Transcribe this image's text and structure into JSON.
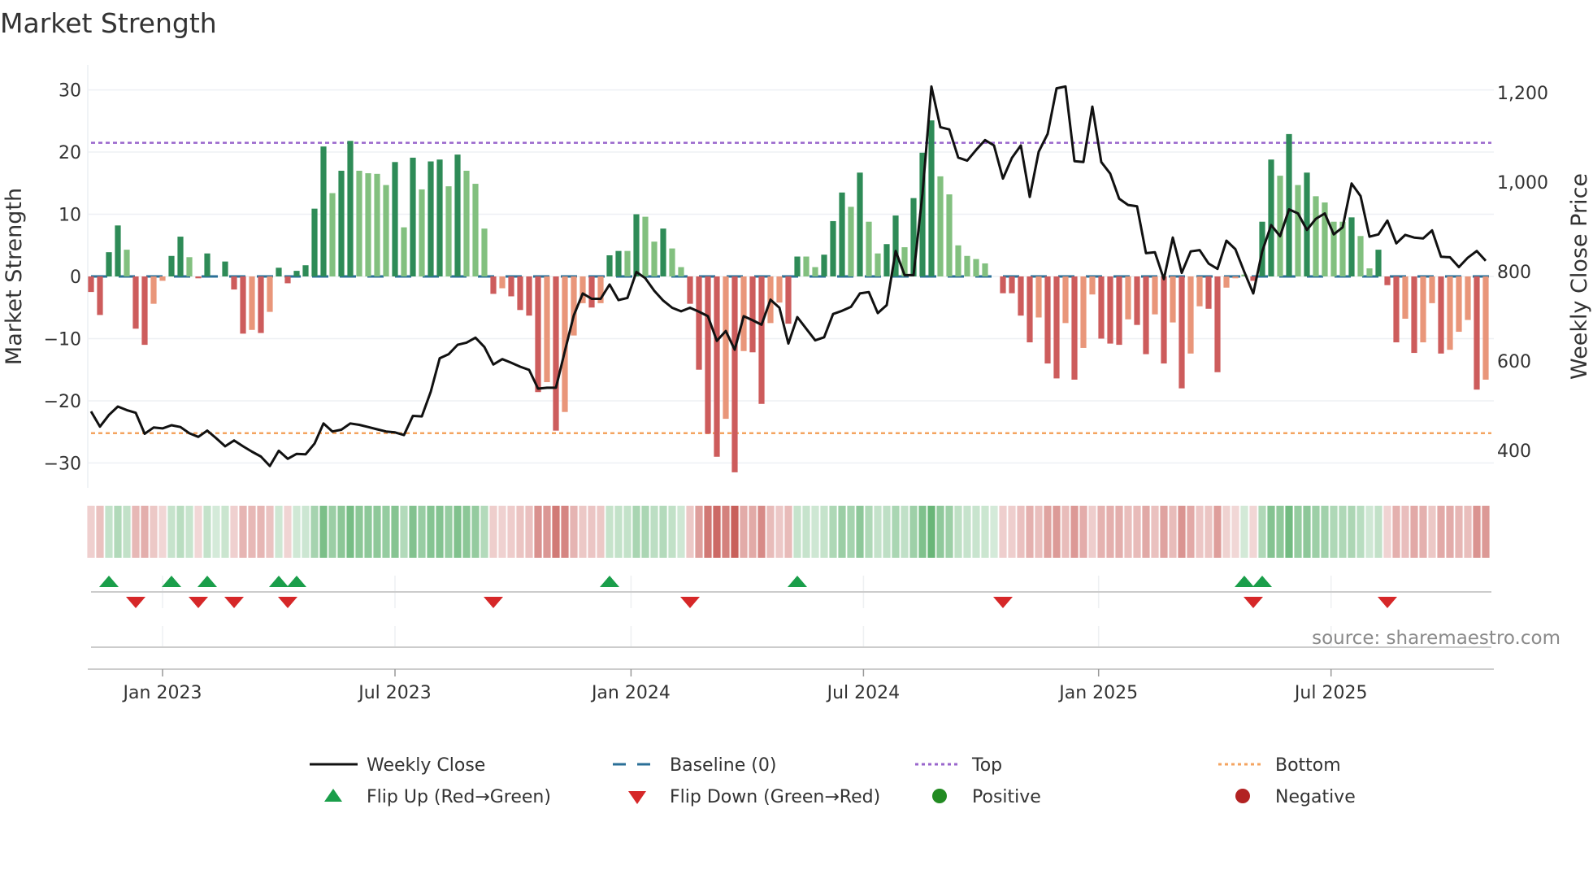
{
  "chart_data": {
    "type": "bar",
    "title": "Market Strength",
    "ylabel": "Market Strength",
    "ylabel_right": "Weekly Close Price",
    "ylim": [
      -34,
      34
    ],
    "ylim_right": [
      316,
      1262
    ],
    "yticks": [
      30,
      20,
      10,
      0,
      -10,
      -20,
      -30
    ],
    "ytick_labels": [
      "30",
      "20",
      "10",
      "0",
      "−10",
      "−20",
      "−30"
    ],
    "yticks_right": [
      1200,
      1000,
      800,
      600,
      400
    ],
    "ytick_labels_right": [
      "1,200",
      "1,000",
      "800",
      "600",
      "400"
    ],
    "xticks": [
      {
        "week_index": 8.0,
        "label": "Jan 2023"
      },
      {
        "week_index": 34.0,
        "label": "Jul 2023"
      },
      {
        "week_index": 60.4,
        "label": "Jan 2024"
      },
      {
        "week_index": 86.4,
        "label": "Jul 2024"
      },
      {
        "week_index": 112.7,
        "label": "Jan 2025"
      },
      {
        "week_index": 138.7,
        "label": "Jul 2025"
      }
    ],
    "top_level": 21.5,
    "bottom_level": -25.2,
    "baseline": 0,
    "strength": [
      -2.5,
      -6.2,
      3.9,
      8.2,
      4.3,
      -8.4,
      -11,
      -4.4,
      -0.7,
      3.3,
      6.4,
      3.1,
      -0.3,
      3.7,
      0,
      2.4,
      -2.1,
      -9.2,
      -8.6,
      -9.1,
      -5.7,
      1.4,
      -1.1,
      0.9,
      1.8,
      10.9,
      20.9,
      13.4,
      17,
      21.8,
      17,
      16.6,
      16.5,
      14.7,
      18.4,
      7.9,
      19.1,
      14,
      18.5,
      18.8,
      14.5,
      19.6,
      17,
      14.9,
      7.7,
      -2.8,
      -1.9,
      -3.2,
      -5.4,
      -6.3,
      -18.6,
      -17,
      -24.8,
      -21.8,
      -9.5,
      -4.3,
      -5,
      -4.3,
      3.4,
      4.1,
      4.1,
      10,
      9.6,
      5.6,
      7.7,
      4.5,
      1.5,
      -4.4,
      -15,
      -25.3,
      -29,
      -22.9,
      -31.5,
      -12,
      -12.2,
      -20.5,
      -7.5,
      -4.2,
      -7.6,
      3.2,
      3.2,
      1.5,
      3.5,
      8.9,
      13.5,
      11.2,
      16.7,
      8.8,
      3.7,
      5.2,
      9.8,
      4.7,
      12.6,
      19.9,
      25.1,
      16.1,
      13.2,
      5,
      3.3,
      2.8,
      2.1,
      0,
      -2.7,
      -2.7,
      -6.3,
      -10.6,
      -6.6,
      -14,
      -16.4,
      -7.5,
      -16.6,
      -11.5,
      -2.9,
      -10,
      -10.8,
      -11,
      -6.9,
      -7.8,
      -12.5,
      -6.1,
      -14,
      -7.4,
      -18,
      -12.4,
      -4.8,
      -5.2,
      -15.4,
      -1.8,
      -0.3,
      0.3,
      -0.7,
      8.8,
      18.8,
      16.2,
      22.9,
      14.7,
      16.7,
      12.9,
      11.9,
      8.8,
      8.8,
      9.5,
      6.5,
      1.3,
      4.3,
      -1.4,
      -10.6,
      -6.8,
      -12.3,
      -10.6,
      -4.3,
      -12.4,
      -11.8,
      -8.9,
      -7,
      -18.2,
      -16.6
    ],
    "shade": [
      "D",
      "D",
      "D",
      "D",
      "L",
      "D",
      "D",
      "L",
      "L",
      "D",
      "D",
      "L",
      "D",
      "D",
      "L",
      "D",
      "D",
      "D",
      "L",
      "D",
      "L",
      "D",
      "D",
      "D",
      "D",
      "D",
      "D",
      "L",
      "D",
      "D",
      "L",
      "L",
      "L",
      "L",
      "D",
      "L",
      "D",
      "L",
      "D",
      "D",
      "L",
      "D",
      "L",
      "L",
      "L",
      "D",
      "L",
      "D",
      "D",
      "D",
      "D",
      "L",
      "D",
      "L",
      "L",
      "L",
      "D",
      "L",
      "D",
      "D",
      "L",
      "D",
      "L",
      "L",
      "D",
      "L",
      "L",
      "D",
      "D",
      "D",
      "D",
      "L",
      "D",
      "L",
      "D",
      "D",
      "L",
      "L",
      "D",
      "D",
      "L",
      "L",
      "D",
      "D",
      "D",
      "L",
      "D",
      "L",
      "L",
      "D",
      "D",
      "L",
      "D",
      "D",
      "D",
      "L",
      "L",
      "L",
      "L",
      "L",
      "L",
      "L",
      "D",
      "D",
      "D",
      "D",
      "L",
      "D",
      "D",
      "L",
      "D",
      "L",
      "L",
      "D",
      "D",
      "D",
      "L",
      "D",
      "D",
      "L",
      "D",
      "L",
      "D",
      "L",
      "L",
      "D",
      "D",
      "L",
      "L",
      "L",
      "D",
      "D",
      "D",
      "L",
      "D",
      "L",
      "D",
      "L",
      "L",
      "L",
      "L",
      "D",
      "L",
      "L",
      "D",
      "D",
      "D",
      "L",
      "D",
      "L",
      "L",
      "D",
      "L",
      "L",
      "L",
      "D",
      "L"
    ],
    "weekly_close": [
      487,
      453,
      479,
      498,
      490,
      484,
      437,
      451,
      449,
      456,
      452,
      438,
      430,
      444,
      427,
      409,
      422,
      409,
      397,
      386,
      365,
      399,
      381,
      392,
      391,
      415,
      460,
      442,
      446,
      460,
      457,
      452,
      447,
      442,
      440,
      434,
      477,
      476,
      531,
      606,
      615,
      636,
      641,
      652,
      631,
      592,
      604,
      596,
      587,
      580,
      538,
      540,
      540,
      622,
      702,
      751,
      739,
      739,
      771,
      736,
      741,
      799,
      785,
      757,
      735,
      719,
      711,
      719,
      710,
      700,
      645,
      667,
      625,
      700,
      691,
      681,
      737,
      719,
      639,
      698,
      672,
      646,
      653,
      705,
      712,
      721,
      751,
      754,
      707,
      725,
      846,
      792,
      792,
      974,
      1214,
      1123,
      1118,
      1055,
      1048,
      1072,
      1094,
      1082,
      1008,
      1054,
      1082,
      967,
      1068,
      1108,
      1210,
      1214,
      1047,
      1045,
      1169,
      1045,
      1019,
      963,
      949,
      946,
      841,
      843,
      783,
      876,
      797,
      845,
      848,
      818,
      806,
      869,
      850,
      799,
      751,
      845,
      904,
      879,
      939,
      930,
      893,
      918,
      930,
      883,
      899,
      997,
      969,
      878,
      883,
      914,
      863,
      882,
      876,
      874,
      892,
      833,
      832,
      810,
      831,
      846,
      824
    ],
    "flip_up": [
      2,
      9,
      13,
      21,
      23,
      58,
      79,
      129,
      131
    ],
    "flip_down": [
      5,
      12,
      16,
      22,
      45,
      67,
      102,
      130,
      145
    ],
    "colors": {
      "positive_dark": "#2e8b57",
      "positive_light": "#82c07f",
      "negative_dark": "#cd5c5c",
      "negative_light": "#e9967a",
      "line": "#111111",
      "baseline": "#2a6f97",
      "top": "#9966cc",
      "bottom": "#f4a460",
      "flip_up": "#1a9e4a",
      "flip_down": "#d62728",
      "positive_marker": "#228b22",
      "negative_marker": "#b22222"
    },
    "legend": {
      "weekly_close": "Weekly Close",
      "baseline": "Baseline (0)",
      "top": "Top",
      "bottom": "Bottom",
      "flip_up": "Flip Up (Red→Green)",
      "flip_down": "Flip Down (Green→Red)",
      "positive": "Positive",
      "negative": "Negative"
    },
    "legend_position": "bottom",
    "source": "source: sharemaestro.com"
  }
}
